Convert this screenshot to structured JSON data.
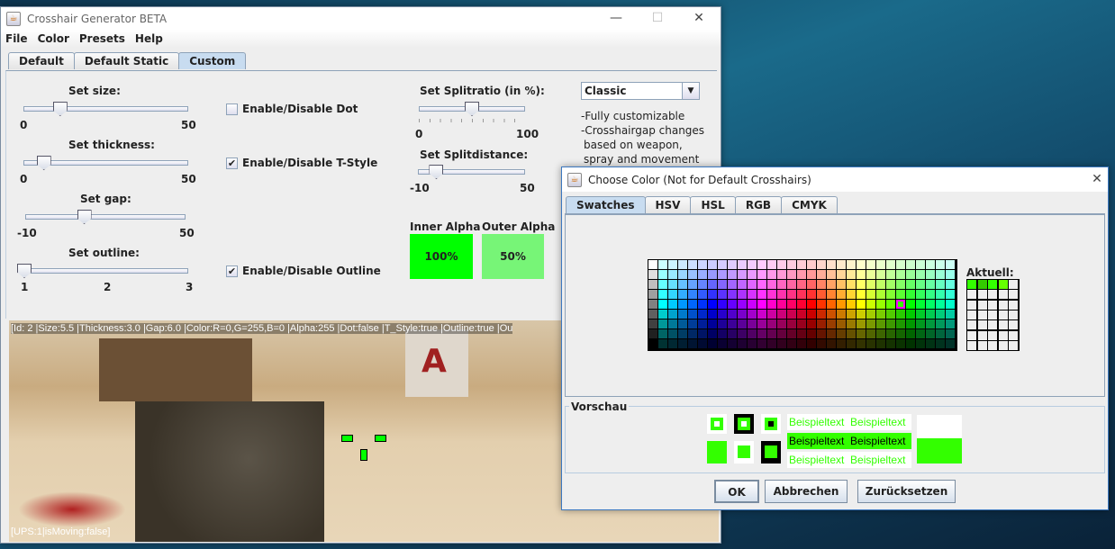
{
  "main_window": {
    "title": "Crosshair Generator BETA",
    "controls": {
      "minimize": "—",
      "maximize": "☐",
      "close": "✕"
    },
    "menu": [
      "File",
      "Color",
      "Presets",
      "Help"
    ],
    "tabs": [
      {
        "label": "Default",
        "selected": false
      },
      {
        "label": "Default Static",
        "selected": false
      },
      {
        "label": "Custom",
        "selected": true
      }
    ],
    "sliders": [
      {
        "label": "Set size:",
        "min": "0",
        "max": "50",
        "value": 11
      },
      {
        "label": "Set thickness:",
        "min": "0",
        "max": "50",
        "value": 6
      },
      {
        "label": "Set gap:",
        "min": "-10",
        "max": "50",
        "value": 12
      },
      {
        "label": "Set outline:",
        "min": "1",
        "mid": "2",
        "max": "3",
        "value": 1
      },
      {
        "label": "Set Splitratio (in %):",
        "min": "0",
        "max": "100",
        "value": 50
      },
      {
        "label": "Set Splitdistance:",
        "min": "-10",
        "max": "50",
        "value": 0
      }
    ],
    "checkboxes": [
      {
        "label": "Enable/Disable Dot",
        "checked": false
      },
      {
        "label": "Enable/Disable T-Style",
        "checked": true
      },
      {
        "label": "Enable/Disable Outline",
        "checked": true
      }
    ],
    "preset_select": "Classic",
    "description": [
      "-Fully customizable",
      "-Crosshairgap changes",
      "based on weapon,",
      "spray and movement"
    ],
    "inner_alpha": {
      "label": "Inner Alpha",
      "value": "100%",
      "color": "#00ff00"
    },
    "outer_alpha": {
      "label": "Outer Alpha",
      "value": "50%",
      "color": "#77f577"
    },
    "status_top": "[Id: 2 |Size:5.5 |Thickness:3.0 |Gap:6.0 |Color:R=0,G=255,B=0 |Alpha:255 |Dot:false |T_Style:true |Outline:true |Ou",
    "status_bottom": "[UPS:1|isMoving:false]",
    "crosshair_color": "#22ee22"
  },
  "color_dialog": {
    "title": "Choose Color (Not for Default Crosshairs)",
    "close": "✕",
    "tabs": [
      {
        "label": "Swatches",
        "selected": true
      },
      {
        "label": "HSV"
      },
      {
        "label": "HSL"
      },
      {
        "label": "RGB"
      },
      {
        "label": "CMYK"
      }
    ],
    "recent_label": "Aktuell:",
    "recent_colors": [
      "#33ff00",
      "#33cc00",
      "#33ff00",
      "#66ff00"
    ],
    "preview_label": "Vorschau",
    "sample_text": "Beispieltext",
    "preview_color": "#33ff00",
    "buttons": {
      "ok": "OK",
      "cancel": "Abbrechen",
      "reset": "Zurücksetzen"
    }
  }
}
